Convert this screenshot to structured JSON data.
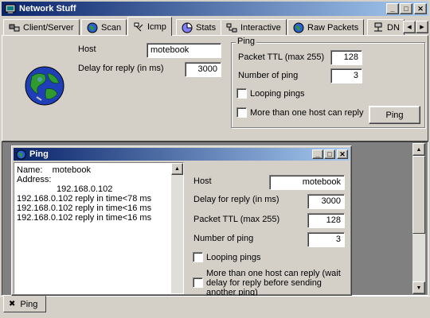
{
  "window": {
    "title": "Network Stuff"
  },
  "tabs": [
    {
      "label": "Client/Server",
      "icon": "client-server-icon"
    },
    {
      "label": "Scan",
      "icon": "globe-icon"
    },
    {
      "label": "Icmp",
      "icon": "satellite-icon"
    },
    {
      "label": "Stats",
      "icon": "pie-icon"
    },
    {
      "label": "Interactive",
      "icon": "network-icon"
    },
    {
      "label": "Raw Packets",
      "icon": "globe-icon"
    },
    {
      "label": "DN",
      "icon": "dns-icon"
    }
  ],
  "active_tab": "Icmp",
  "icmp": {
    "host_label": "Host",
    "host_value": "motebook",
    "delay_label": "Delay for reply (in ms)",
    "delay_value": "3000",
    "ping_group": {
      "title": "Ping",
      "ttl_label": "Packet TTL (max 255)",
      "ttl_value": "128",
      "count_label": "Number of ping",
      "count_value": "3",
      "looping_label": "Looping pings",
      "multi_label": "More than one host can reply",
      "ping_button": "Ping"
    }
  },
  "child": {
    "title": "Ping",
    "log": {
      "name_label": "Name:",
      "name_value": "motebook",
      "address_label": "Address:",
      "address_value": "192.168.0.102",
      "lines": [
        "192.168.0.102 reply in time<78 ms",
        "192.168.0.102 reply in time<16 ms",
        "192.168.0.102 reply in time<16 ms"
      ]
    },
    "host_label": "Host",
    "host_value": "motebook",
    "delay_label": "Delay for reply (in ms)",
    "delay_value": "3000",
    "ttl_label": "Packet TTL (max 255)",
    "ttl_value": "128",
    "count_label": "Number of ping",
    "count_value": "3",
    "looping_label": "Looping pings",
    "multi_label": "More than one host can reply (wait delay for reply before sending another ping)"
  },
  "taskbar": {
    "tab_label": "Ping",
    "close_glyph": "✖"
  }
}
